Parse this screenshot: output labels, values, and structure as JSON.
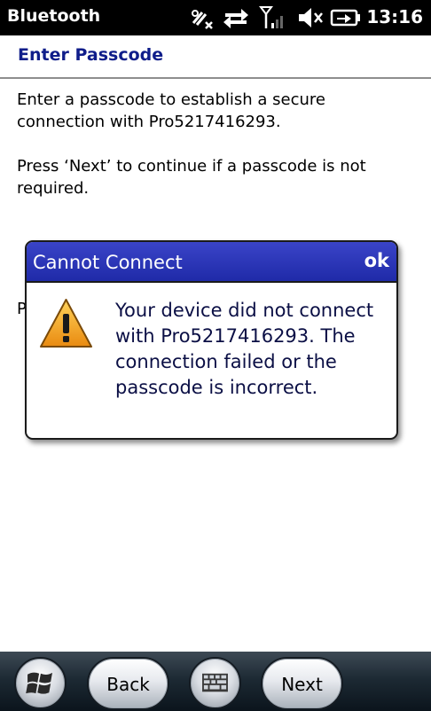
{
  "status_bar": {
    "title": "Bluetooth",
    "time": "13:16",
    "icons": [
      "no-data-icon",
      "data-arrows-icon",
      "signal-icon",
      "volume-muted-icon",
      "battery-charging-icon"
    ]
  },
  "header": {
    "title": "Enter Passcode"
  },
  "content": {
    "paragraph_1": "Enter a passcode to establish a secure connection with Pro5217416293.",
    "paragraph_2": "Press ‘Next’ to continue if a passcode is not required.",
    "paragraph_3_visible": "P"
  },
  "dialog": {
    "title": "Cannot Connect",
    "ok_label": "ok",
    "message": "Your device did not connect with Pro5217416293. The connection failed or the passcode is incorrect.",
    "icon": "warning-icon"
  },
  "bottom_bar": {
    "start_icon": "windows-logo-icon",
    "back_label": "Back",
    "keyboard_icon": "keyboard-icon",
    "next_label": "Next"
  },
  "colors": {
    "header_title": "#0f1d8a",
    "dialog_titlebar": "#2a35b8",
    "dialog_text": "#0b0f45",
    "warning_fill": "#f4a21b"
  }
}
